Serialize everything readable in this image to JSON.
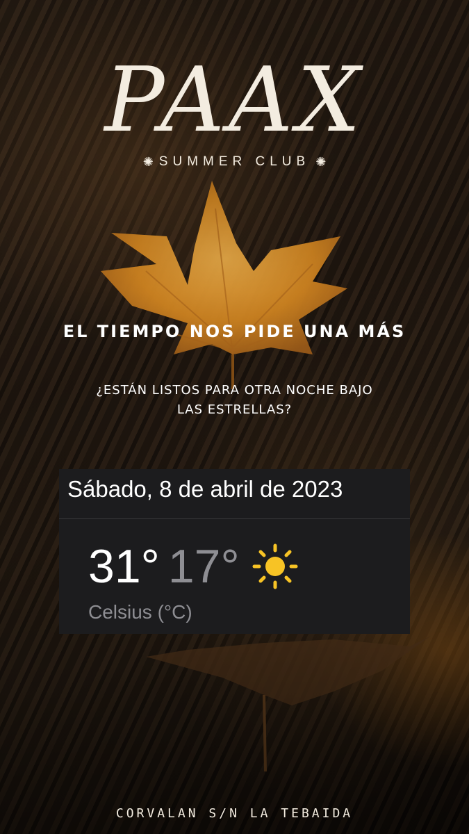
{
  "brand": {
    "name": "PAAX",
    "tagline": "SUMMER CLUB"
  },
  "headline": "EL TIEMPO NOS PIDE UNA MÁS",
  "subline": {
    "line1": "¿ESTÁN LISTOS PARA OTRA NOCHE BAJO",
    "line2": "LAS ESTRELLAS?"
  },
  "weather": {
    "date": "Sábado, 8 de abril de 2023",
    "high": "31°",
    "low": "17°",
    "unit": "Celsius (°C)",
    "icon": "sun-icon"
  },
  "address": "CORVALAN S/N LA TEBAIDA",
  "colors": {
    "text_cream": "#f3ece0",
    "leaf_orange": "#e39a2a",
    "widget_bg": "#1c1c1e",
    "sun_yellow": "#f7c325"
  }
}
